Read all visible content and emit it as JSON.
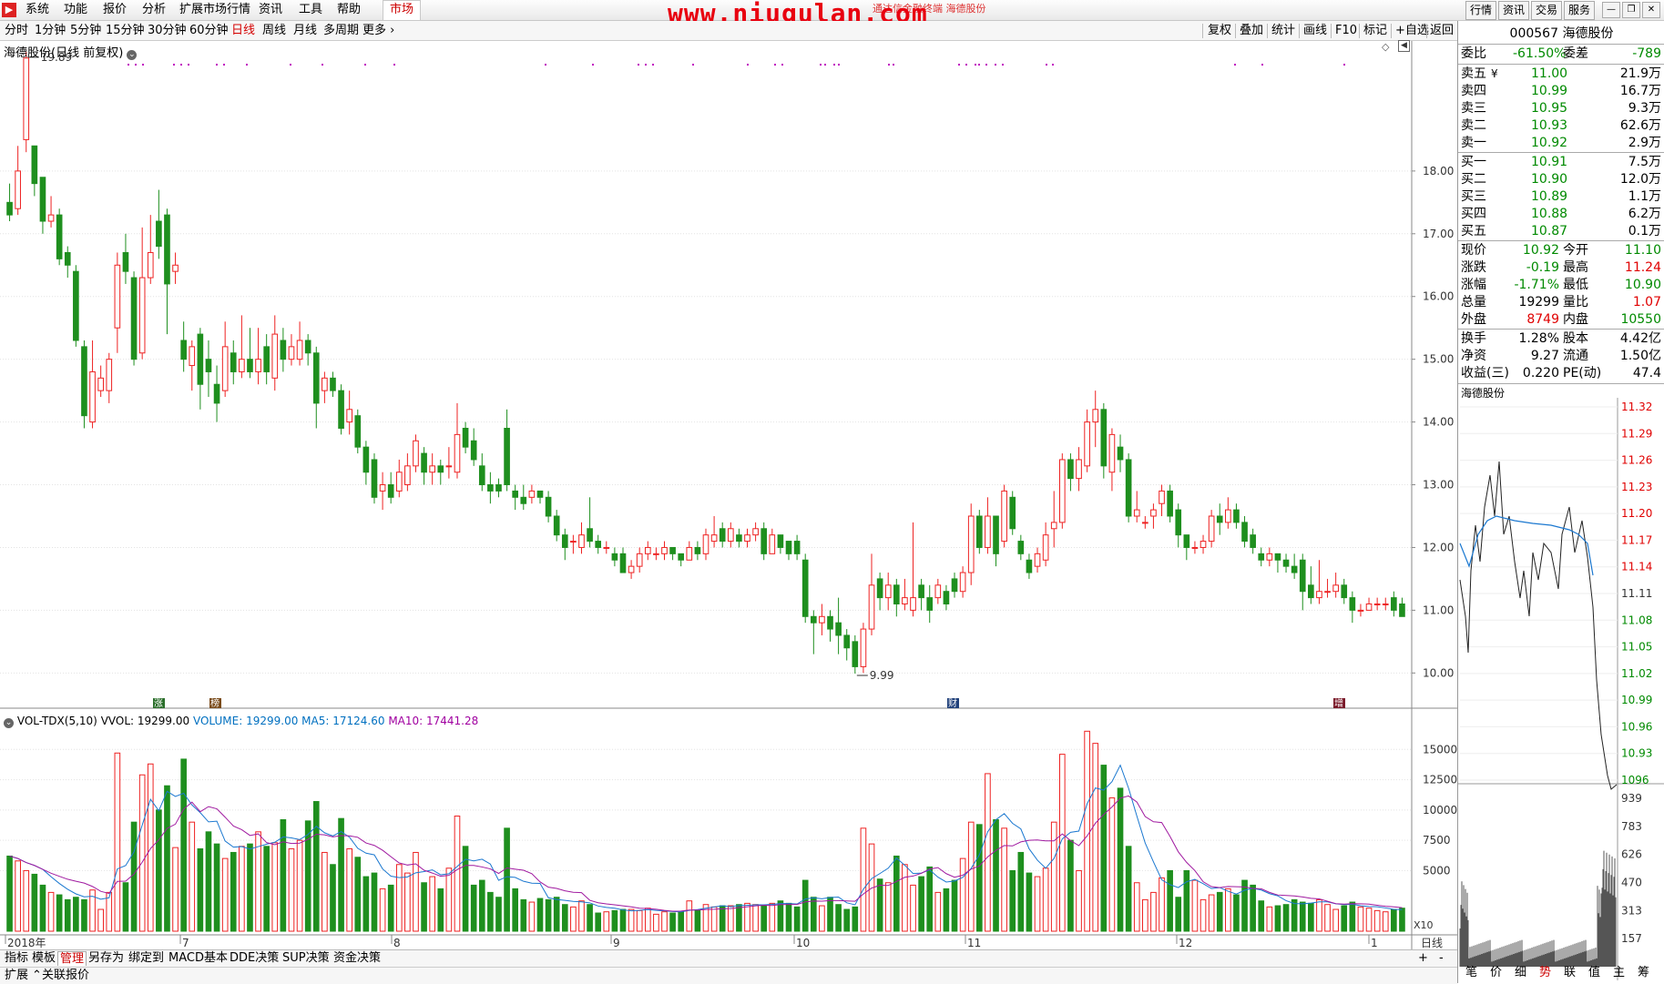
{
  "menu": {
    "logo": "▶",
    "items": [
      "系统",
      "功能",
      "报价",
      "分析",
      "扩展市场行情",
      "资讯",
      "工具",
      "帮助"
    ],
    "market_tab": "市场",
    "watermark": "www.niugulan.com",
    "sub_title": "通达信金融终端  海德股份",
    "right_buttons": [
      "行情",
      "资讯",
      "交易",
      "服务"
    ]
  },
  "periods": [
    "分时",
    "1分钟",
    "5分钟",
    "15分钟",
    "30分钟",
    "60分钟",
    "日线",
    "周线",
    "月线",
    "多周期",
    "更多"
  ],
  "active_period": "日线",
  "tools": [
    "复权",
    "叠加",
    "统计",
    "画线",
    "F10",
    "标记",
    "+自选",
    "返回"
  ],
  "main_title": "海德股份(日线 前复权)",
  "max_label": "19.89",
  "min_label": "9.99",
  "markers": [
    "涨",
    "榜",
    "财",
    "增"
  ],
  "volume_header": {
    "name": "VOL-TDX(5,10)",
    "vvol": "VVOL: 19299.00",
    "volume": "VOLUME: 19299.00",
    "ma5": "MA5: 17124.60",
    "ma10": "MA10: 17441.28"
  },
  "date_axis": [
    "2018年",
    "7",
    "8",
    "9",
    "10",
    "11",
    "12",
    "1"
  ],
  "axis_label_right": "日线",
  "bottom_tabs": [
    "指标",
    "模板",
    "管理",
    "另存为",
    "绑定到",
    "MACD基本",
    "DDE决策",
    "SUP决策",
    "资金决策"
  ],
  "bottom_tabs2": [
    "扩展",
    "关联报价"
  ],
  "quote": {
    "code": "000567",
    "name": "海德股份",
    "weibi_label": "委比",
    "weibi": "-61.50%",
    "weicha_label": "委差",
    "weicha": "-789",
    "asks": [
      {
        "label": "卖五",
        "sym": "¥",
        "price": "11.00",
        "vol": "21.9万"
      },
      {
        "label": "卖四",
        "sym": "",
        "price": "10.99",
        "vol": "16.7万"
      },
      {
        "label": "卖三",
        "sym": "",
        "price": "10.95",
        "vol": "9.3万"
      },
      {
        "label": "卖二",
        "sym": "",
        "price": "10.93",
        "vol": "62.6万"
      },
      {
        "label": "卖一",
        "sym": "",
        "price": "10.92",
        "vol": "2.9万"
      }
    ],
    "bids": [
      {
        "label": "买一",
        "price": "10.91",
        "vol": "7.5万"
      },
      {
        "label": "买二",
        "price": "10.90",
        "vol": "12.0万"
      },
      {
        "label": "买三",
        "price": "10.89",
        "vol": "1.1万"
      },
      {
        "label": "买四",
        "price": "10.88",
        "vol": "6.2万"
      },
      {
        "label": "买五",
        "price": "10.87",
        "vol": "0.1万"
      }
    ],
    "stats": [
      {
        "l1": "现价",
        "v1": "10.92",
        "c1": "green",
        "l2": "今开",
        "v2": "11.10",
        "c2": "green"
      },
      {
        "l1": "涨跌",
        "v1": "-0.19",
        "c1": "green",
        "l2": "最高",
        "v2": "11.24",
        "c2": "red"
      },
      {
        "l1": "涨幅",
        "v1": "-1.71%",
        "c1": "green",
        "l2": "最低",
        "v2": "10.90",
        "c2": "green"
      },
      {
        "l1": "总量",
        "v1": "19299",
        "c1": "black",
        "l2": "量比",
        "v2": "1.07",
        "c2": "red"
      },
      {
        "l1": "外盘",
        "v1": "8749",
        "c1": "red",
        "l2": "内盘",
        "v2": "10550",
        "c2": "green"
      }
    ],
    "stats2": [
      {
        "l1": "换手",
        "v1": "1.28%",
        "l2": "股本",
        "v2": "4.42亿"
      },
      {
        "l1": "净资",
        "v1": "9.27",
        "l2": "流通",
        "v2": "1.50亿"
      },
      {
        "l1": "收益(三)",
        "v1": "0.220",
        "l2": "PE(动)",
        "v2": "47.4"
      }
    ],
    "mini_title": "海德股份",
    "mini_axis": [
      "11.32",
      "11.29",
      "11.26",
      "11.23",
      "11.20",
      "11.17",
      "11.14",
      "11.11",
      "11.08",
      "11.05",
      "11.02",
      "10.99",
      "10.96",
      "10.93",
      "1096"
    ],
    "mini_vol_axis": [
      "939",
      "783",
      "626",
      "470",
      "313",
      "157"
    ],
    "buttons": [
      "笔",
      "价",
      "细",
      "势",
      "联",
      "值",
      "主",
      "筹"
    ],
    "active_button": "势"
  },
  "chart_data": {
    "type": "candlestick",
    "title": "海德股份(日线 前复权)",
    "y_ticks": [
      10.0,
      11.0,
      12.0,
      13.0,
      14.0,
      15.0,
      16.0,
      17.0,
      18.0
    ],
    "ylim": [
      9.7,
      20.0
    ],
    "vol_ticks": [
      5000,
      7500,
      10000,
      12500,
      15000
    ],
    "vol_max": 17500,
    "candles": [
      [
        17.5,
        17.3,
        17.8,
        17.2,
        6200
      ],
      [
        17.4,
        18.0,
        18.4,
        17.3,
        5800
      ],
      [
        18.5,
        19.8,
        19.9,
        18.3,
        5000
      ],
      [
        18.4,
        17.8,
        18.4,
        17.6,
        4700
      ],
      [
        17.9,
        17.2,
        17.9,
        17.0,
        3800
      ],
      [
        17.2,
        17.3,
        17.6,
        17.1,
        3200
      ],
      [
        17.3,
        16.6,
        17.4,
        16.5,
        3000
      ],
      [
        16.7,
        16.5,
        16.8,
        16.3,
        2600
      ],
      [
        16.4,
        15.3,
        16.5,
        15.2,
        2800
      ],
      [
        15.2,
        14.1,
        15.3,
        13.9,
        2600
      ],
      [
        14.0,
        14.8,
        15.3,
        13.9,
        3400
      ],
      [
        14.5,
        14.7,
        14.9,
        14.4,
        1800
      ],
      [
        14.5,
        15.0,
        15.1,
        14.3,
        3200
      ],
      [
        15.5,
        16.5,
        16.7,
        15.1,
        14700
      ],
      [
        16.7,
        16.4,
        17.0,
        16.2,
        4000
      ],
      [
        16.3,
        15.0,
        16.4,
        14.9,
        9000
      ],
      [
        15.1,
        16.3,
        17.1,
        15.0,
        12900
      ],
      [
        16.3,
        16.7,
        17.3,
        16.2,
        13800
      ],
      [
        17.2,
        16.8,
        17.7,
        16.6,
        10000
      ],
      [
        17.3,
        16.2,
        17.4,
        15.4,
        12000
      ],
      [
        16.4,
        16.5,
        16.7,
        16.2,
        6900
      ],
      [
        15.3,
        15.0,
        15.6,
        14.8,
        14200
      ],
      [
        14.9,
        15.2,
        15.3,
        14.5,
        9000
      ],
      [
        15.4,
        14.6,
        15.5,
        14.2,
        6800
      ],
      [
        15.0,
        14.8,
        15.3,
        14.4,
        8200
      ],
      [
        14.6,
        14.3,
        14.9,
        14.0,
        7200
      ],
      [
        14.5,
        15.2,
        15.6,
        14.4,
        6000
      ],
      [
        15.1,
        14.8,
        15.3,
        14.6,
        6500
      ],
      [
        14.8,
        15.0,
        15.7,
        14.7,
        7000
      ],
      [
        15.0,
        14.8,
        15.5,
        14.7,
        7200
      ],
      [
        14.8,
        15.0,
        15.5,
        14.6,
        8200
      ],
      [
        15.2,
        14.8,
        15.4,
        14.6,
        7000
      ],
      [
        14.7,
        15.4,
        15.7,
        14.5,
        7300
      ],
      [
        15.3,
        15.0,
        15.5,
        14.8,
        9200
      ],
      [
        15.0,
        15.2,
        15.4,
        14.9,
        6800
      ],
      [
        15.0,
        15.3,
        15.6,
        14.9,
        7500
      ],
      [
        15.3,
        15.1,
        15.4,
        14.9,
        9100
      ],
      [
        15.1,
        14.3,
        15.2,
        13.9,
        10700
      ],
      [
        14.5,
        14.7,
        14.8,
        14.3,
        6500
      ],
      [
        14.7,
        14.5,
        14.8,
        14.4,
        5500
      ],
      [
        14.5,
        13.9,
        14.6,
        13.8,
        9300
      ],
      [
        14.0,
        14.2,
        14.5,
        13.8,
        6800
      ],
      [
        14.1,
        13.6,
        14.2,
        13.5,
        6100
      ],
      [
        13.6,
        13.2,
        13.7,
        13.0,
        4500
      ],
      [
        13.4,
        12.8,
        13.5,
        12.7,
        4800
      ],
      [
        12.9,
        13.0,
        13.2,
        12.6,
        3500
      ],
      [
        13.0,
        12.8,
        13.2,
        12.7,
        3800
      ],
      [
        12.9,
        13.2,
        13.4,
        12.8,
        5500
      ],
      [
        13.0,
        13.3,
        13.5,
        12.9,
        4800
      ],
      [
        13.3,
        13.7,
        13.8,
        13.2,
        6500
      ],
      [
        13.5,
        13.2,
        13.6,
        13.0,
        4000
      ],
      [
        13.2,
        13.3,
        13.5,
        13.0,
        4500
      ],
      [
        13.3,
        13.2,
        13.4,
        13.0,
        3500
      ],
      [
        13.3,
        13.3,
        13.6,
        13.1,
        5200
      ],
      [
        13.2,
        13.8,
        14.3,
        13.1,
        9500
      ],
      [
        13.9,
        13.6,
        14.0,
        13.5,
        7000
      ],
      [
        13.7,
        13.4,
        13.9,
        13.3,
        3800
      ],
      [
        13.3,
        13.0,
        13.5,
        12.9,
        4200
      ],
      [
        13.0,
        12.9,
        13.2,
        12.7,
        3200
      ],
      [
        13.0,
        12.9,
        13.1,
        12.8,
        2800
      ],
      [
        13.9,
        13.0,
        14.2,
        12.9,
        8500
      ],
      [
        12.9,
        12.8,
        13.0,
        12.6,
        3500
      ],
      [
        12.8,
        12.7,
        13.0,
        12.6,
        2600
      ],
      [
        12.8,
        12.9,
        13.0,
        12.7,
        2400
      ],
      [
        12.9,
        12.8,
        12.9,
        12.7,
        2700
      ],
      [
        12.8,
        12.5,
        12.9,
        12.4,
        2600
      ],
      [
        12.5,
        12.2,
        12.6,
        12.1,
        2800
      ],
      [
        12.2,
        12.0,
        12.3,
        11.8,
        2200
      ],
      [
        12.1,
        12.1,
        12.2,
        11.9,
        2000
      ],
      [
        12.0,
        12.2,
        12.4,
        11.9,
        2500
      ],
      [
        12.3,
        12.1,
        12.8,
        12.0,
        2200
      ],
      [
        12.1,
        12.0,
        12.2,
        11.9,
        1500
      ],
      [
        12.0,
        12.0,
        12.1,
        11.9,
        1600
      ],
      [
        11.9,
        11.8,
        12.0,
        11.7,
        1700
      ],
      [
        11.9,
        11.6,
        12.0,
        11.6,
        1800
      ],
      [
        11.6,
        11.7,
        11.8,
        11.5,
        1800
      ],
      [
        11.7,
        11.9,
        12.0,
        11.6,
        1700
      ],
      [
        11.9,
        12.0,
        12.1,
        11.8,
        1900
      ],
      [
        11.9,
        11.9,
        12.0,
        11.8,
        1400
      ],
      [
        11.9,
        12.0,
        12.1,
        11.8,
        1600
      ],
      [
        12.0,
        11.9,
        12.0,
        11.8,
        1500
      ],
      [
        11.9,
        11.8,
        11.9,
        11.7,
        1600
      ],
      [
        11.8,
        12.0,
        12.1,
        11.8,
        2500
      ],
      [
        12.0,
        11.9,
        12.1,
        11.8,
        1700
      ],
      [
        11.9,
        12.2,
        12.3,
        11.8,
        2200
      ],
      [
        12.1,
        12.2,
        12.5,
        12.0,
        2000
      ],
      [
        12.3,
        12.1,
        12.4,
        12.0,
        2100
      ],
      [
        12.1,
        12.3,
        12.4,
        12.0,
        2100
      ],
      [
        12.2,
        12.1,
        12.3,
        12.0,
        2200
      ],
      [
        12.1,
        12.2,
        12.3,
        12.0,
        2300
      ],
      [
        12.2,
        12.3,
        12.4,
        12.1,
        2200
      ],
      [
        12.3,
        11.9,
        12.4,
        11.8,
        2100
      ],
      [
        11.9,
        12.2,
        12.3,
        11.9,
        2300
      ],
      [
        12.2,
        12.0,
        12.2,
        11.9,
        2500
      ],
      [
        12.1,
        11.9,
        12.1,
        11.8,
        2300
      ],
      [
        12.1,
        11.9,
        12.2,
        11.8,
        2000
      ],
      [
        11.8,
        10.9,
        11.9,
        10.8,
        4200
      ],
      [
        10.9,
        10.8,
        11.0,
        10.3,
        2800
      ],
      [
        10.8,
        10.9,
        11.1,
        10.6,
        2100
      ],
      [
        10.9,
        10.7,
        11.0,
        10.5,
        2800
      ],
      [
        10.8,
        10.6,
        11.2,
        10.3,
        2200
      ],
      [
        10.6,
        10.4,
        10.7,
        10.2,
        1800
      ],
      [
        10.5,
        10.1,
        10.6,
        9.99,
        2000
      ],
      [
        10.1,
        10.7,
        10.8,
        10.0,
        8500
      ],
      [
        10.7,
        11.4,
        11.9,
        10.6,
        7200
      ],
      [
        11.5,
        11.2,
        11.6,
        11.0,
        4300
      ],
      [
        11.2,
        11.4,
        11.6,
        11.0,
        4000
      ],
      [
        11.4,
        11.1,
        11.5,
        10.9,
        6200
      ],
      [
        11.1,
        11.2,
        11.5,
        11.0,
        5500
      ],
      [
        11.0,
        11.2,
        12.4,
        10.9,
        3800
      ],
      [
        11.4,
        11.2,
        11.5,
        11.0,
        4500
      ],
      [
        11.2,
        11.0,
        11.4,
        10.8,
        5300
      ],
      [
        11.2,
        11.4,
        11.5,
        11.1,
        3200
      ],
      [
        11.3,
        11.1,
        11.4,
        11.0,
        3500
      ],
      [
        11.5,
        11.3,
        11.6,
        11.2,
        4200
      ],
      [
        11.3,
        11.6,
        11.7,
        11.2,
        6000
      ],
      [
        11.6,
        12.5,
        12.7,
        11.4,
        9000
      ],
      [
        12.5,
        12.0,
        12.6,
        11.9,
        8800
      ],
      [
        12.0,
        12.5,
        12.8,
        11.9,
        13000
      ],
      [
        12.5,
        11.9,
        12.5,
        11.7,
        9200
      ],
      [
        12.1,
        12.9,
        13.0,
        12.0,
        8500
      ],
      [
        12.8,
        12.3,
        12.9,
        12.2,
        5000
      ],
      [
        12.1,
        11.9,
        12.2,
        11.8,
        6500
      ],
      [
        11.8,
        11.6,
        11.9,
        11.5,
        4800
      ],
      [
        11.7,
        11.9,
        12.0,
        11.6,
        4500
      ],
      [
        11.8,
        12.2,
        12.4,
        11.7,
        5200
      ],
      [
        12.3,
        12.4,
        12.9,
        12.0,
        9000
      ],
      [
        12.4,
        13.4,
        13.5,
        12.3,
        14600
      ],
      [
        13.4,
        13.1,
        13.5,
        12.9,
        7500
      ],
      [
        13.1,
        13.4,
        13.6,
        12.9,
        5000
      ],
      [
        13.3,
        14.0,
        14.2,
        13.2,
        16500
      ],
      [
        14.0,
        14.2,
        14.5,
        13.6,
        15500
      ],
      [
        14.2,
        13.3,
        14.3,
        13.1,
        13700
      ],
      [
        13.2,
        13.8,
        13.9,
        12.9,
        11000
      ],
      [
        13.6,
        13.4,
        13.8,
        13.2,
        11800
      ],
      [
        13.4,
        12.5,
        13.5,
        12.4,
        7000
      ],
      [
        12.5,
        12.6,
        12.9,
        12.4,
        4000
      ],
      [
        12.4,
        12.4,
        12.5,
        12.3,
        2600
      ],
      [
        12.5,
        12.6,
        12.7,
        12.3,
        3200
      ],
      [
        12.7,
        12.9,
        13.0,
        12.5,
        4400
      ],
      [
        12.9,
        12.5,
        13.0,
        12.4,
        5000
      ],
      [
        12.6,
        12.2,
        12.7,
        12.0,
        2800
      ],
      [
        12.2,
        12.0,
        12.2,
        11.8,
        5000
      ],
      [
        12.0,
        12.0,
        12.1,
        11.9,
        4200
      ],
      [
        12.0,
        12.1,
        12.2,
        11.9,
        2600
      ],
      [
        12.1,
        12.5,
        12.6,
        12.0,
        3000
      ],
      [
        12.5,
        12.4,
        12.7,
        12.2,
        3200
      ],
      [
        12.4,
        12.6,
        12.8,
        12.3,
        3500
      ],
      [
        12.6,
        12.4,
        12.7,
        12.3,
        3000
      ],
      [
        12.4,
        12.1,
        12.5,
        12.0,
        4200
      ],
      [
        12.2,
        12.0,
        12.3,
        11.9,
        3800
      ],
      [
        11.9,
        11.8,
        12.0,
        11.7,
        2500
      ],
      [
        11.8,
        11.9,
        12.0,
        11.7,
        2000
      ],
      [
        11.9,
        11.8,
        11.9,
        11.6,
        2100
      ],
      [
        11.8,
        11.7,
        11.9,
        11.6,
        2200
      ],
      [
        11.7,
        11.6,
        11.9,
        11.5,
        2600
      ],
      [
        11.8,
        11.3,
        11.9,
        11.0,
        2400
      ],
      [
        11.4,
        11.2,
        11.7,
        11.1,
        2300
      ],
      [
        11.2,
        11.3,
        11.8,
        11.1,
        2600
      ],
      [
        11.3,
        11.3,
        11.5,
        11.2,
        2200
      ],
      [
        11.3,
        11.4,
        11.6,
        11.2,
        1800
      ],
      [
        11.4,
        11.2,
        11.5,
        11.1,
        2100
      ],
      [
        11.2,
        11.0,
        11.3,
        10.8,
        2400
      ],
      [
        11.0,
        11.0,
        11.1,
        10.9,
        2000
      ],
      [
        11.0,
        11.1,
        11.2,
        11.0,
        1900
      ],
      [
        11.1,
        11.1,
        11.2,
        11.0,
        1700
      ],
      [
        11.1,
        11.1,
        11.2,
        11.0,
        1600
      ],
      [
        11.2,
        11.0,
        11.3,
        10.9,
        1800
      ],
      [
        11.1,
        10.9,
        11.2,
        10.9,
        1900
      ]
    ]
  }
}
